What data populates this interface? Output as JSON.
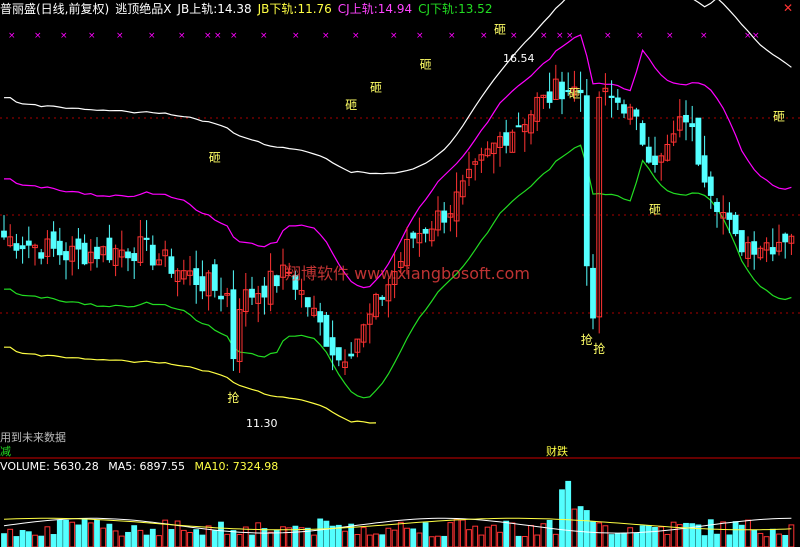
{
  "header": {
    "stock": "普丽盛(日线,前复权)",
    "indicator": "逃顶绝品X",
    "jb_upper_label": "JB上轨:",
    "jb_upper_value": "14.38",
    "jb_lower_label": "JB下轨:",
    "jb_lower_value": "11.76",
    "cj_upper_label": "CJ上轨:",
    "cj_upper_value": "14.94",
    "cj_lower_label": "CJ下轨:",
    "cj_lower_value": "13.52"
  },
  "close_glyph": "✕",
  "watermark": "翔博软件 www.xiangbosoft.com",
  "note": "用到未来数据",
  "left_label": "减",
  "sell_label": "财跌",
  "signals": {
    "sell": "砸",
    "buy": "抢"
  },
  "volume_header": {
    "volume_label": "VOLUME:",
    "volume_value": "5630.28",
    "ma5_label": "MA5:",
    "ma5_value": "6897.55",
    "ma10_label": "MA10:",
    "ma10_value": "7324.98"
  },
  "colors": {
    "up": "#ff3333",
    "down": "#54ffff",
    "upper_band": "#ff00ff",
    "lower_band": "#22dd22",
    "white_line": "#ffffff",
    "yellow_line": "#ffff44",
    "header_white": "#ffffff",
    "header_yellow": "#ffff44",
    "header_magenta": "#ff44ff",
    "header_green": "#22dd22",
    "separator": "#cc0000",
    "dotted": "#aa0000",
    "marker": "#ff00ff"
  },
  "chart_data": {
    "type": "candlestick",
    "y_range": [
      10.3,
      17.4
    ],
    "annotations": [
      {
        "type": "high",
        "value": 16.54,
        "label": "16.54"
      },
      {
        "type": "low",
        "value": 11.3,
        "label": "11.30"
      }
    ],
    "volume_range": [
      0,
      20000
    ],
    "volume_ma": {
      "ma5": 6897.55,
      "ma10": 7324.98,
      "last_volume": 5630.28
    }
  }
}
